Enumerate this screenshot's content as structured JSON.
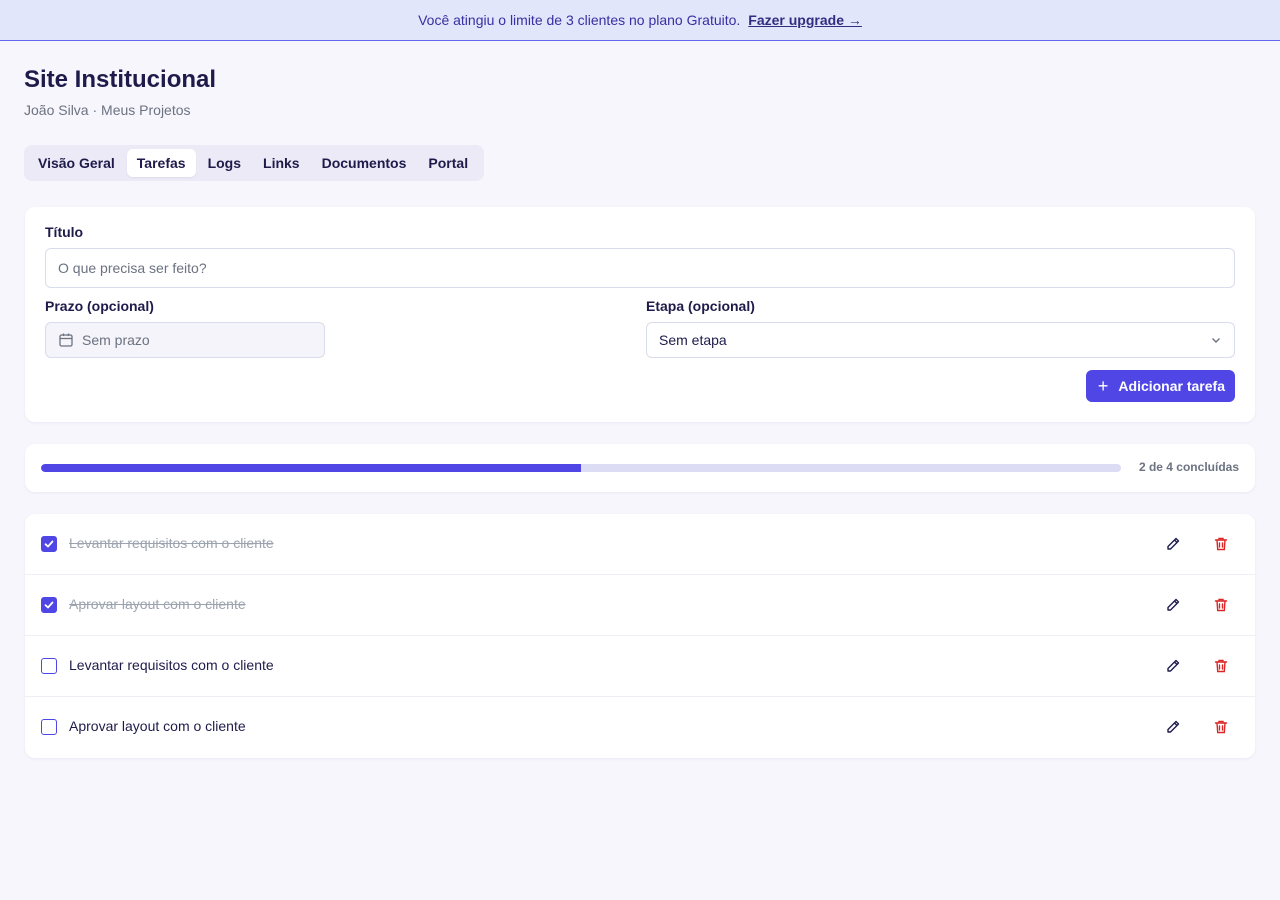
{
  "banner": {
    "message": "Você atingiu o limite de 3 clientes no plano Gratuito.",
    "upgrade_label": "Fazer upgrade →"
  },
  "header": {
    "title": "Site Institucional",
    "breadcrumb": "João Silva · Meus Projetos"
  },
  "tabs": [
    {
      "label": "Visão Geral"
    },
    {
      "label": "Tarefas",
      "active": true
    },
    {
      "label": "Logs"
    },
    {
      "label": "Links"
    },
    {
      "label": "Documentos"
    },
    {
      "label": "Portal"
    }
  ],
  "form": {
    "title_label": "Título",
    "title_placeholder": "O que precisa ser feito?",
    "deadline_label": "Prazo (opcional)",
    "deadline_placeholder": "Sem prazo",
    "stage_label": "Etapa (opcional)",
    "stage_value": "Sem etapa",
    "add_button_label": "Adicionar tarefa"
  },
  "progress": {
    "completed": 2,
    "total": 4,
    "text": "2 de 4 concluídas"
  },
  "tasks": [
    {
      "title": "Levantar requisitos com o cliente",
      "done": true
    },
    {
      "title": "Aprovar layout com o cliente",
      "done": true
    },
    {
      "title": "Levantar requisitos com o cliente",
      "done": false
    },
    {
      "title": "Aprovar layout com o cliente",
      "done": false
    }
  ],
  "colors": {
    "accent": "#4f46e5",
    "danger": "#dc2626",
    "banner_bg": "#e2e6fb"
  },
  "icons": {
    "calendar": "calendar-icon",
    "chevron": "chevron-down-icon",
    "plus": "plus-icon",
    "edit": "pencil-icon",
    "delete": "trash-icon",
    "check": "check-icon"
  }
}
